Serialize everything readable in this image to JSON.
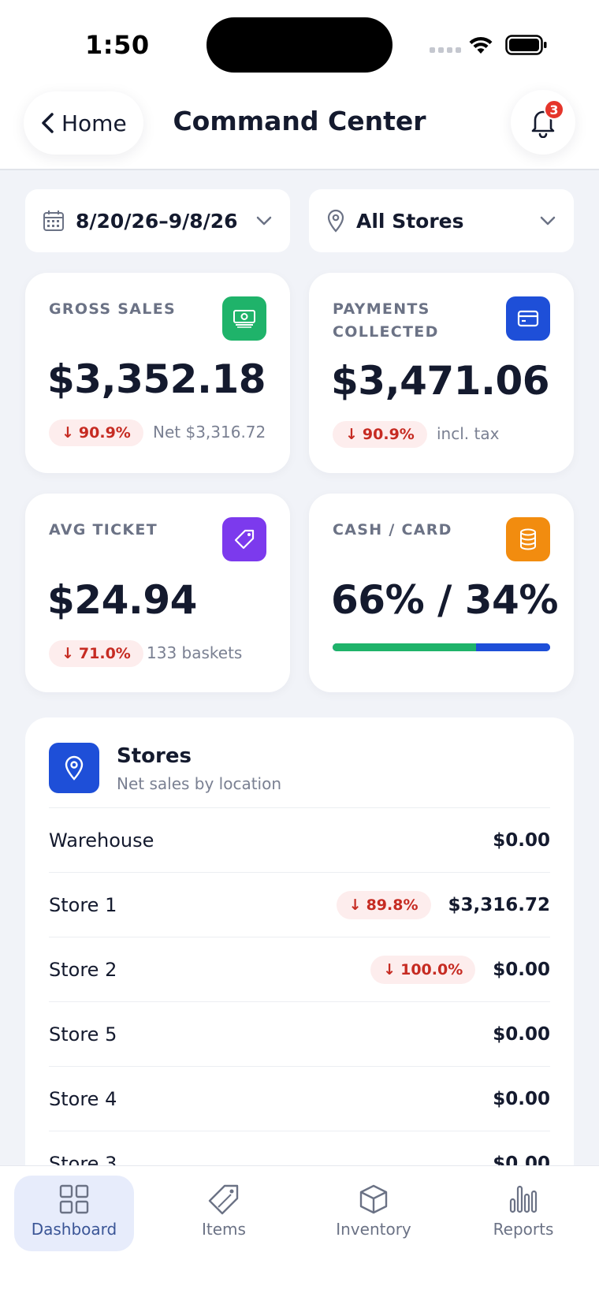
{
  "status_bar": {
    "time": "1:50"
  },
  "header": {
    "back_label": "Home",
    "title": "Command Center",
    "notification_count": "3"
  },
  "filters": {
    "date_range": "8/20/26–9/8/26",
    "store": "All Stores"
  },
  "metrics": {
    "gross_sales": {
      "label": "GROSS SALES",
      "value": "$3,352.18",
      "delta": "90.9%",
      "note": "Net $3,316.72",
      "icon": "banknote-icon",
      "color": "#1fb36a"
    },
    "payments_collected": {
      "label": "PAYMENTS COLLECTED",
      "value": "$3,471.06",
      "delta": "90.9%",
      "note": "incl. tax",
      "icon": "credit-card-icon",
      "color": "#1e4fd8"
    },
    "avg_ticket": {
      "label": "AVG TICKET",
      "value": "$24.94",
      "delta": "71.0%",
      "note": "133 baskets",
      "icon": "tag-icon",
      "color": "#7c3aed"
    },
    "cash_card": {
      "label": "CASH / CARD",
      "value": "66% / 34%",
      "cash_share": 0.66,
      "icon": "database-icon",
      "color": "#f28c0f",
      "cash_color": "#1fb36a",
      "card_color": "#1e4fd8"
    }
  },
  "stores": {
    "title": "Stores",
    "subtitle": "Net sales by location",
    "rows": [
      {
        "name": "Warehouse",
        "amount": "$0.00",
        "delta": ""
      },
      {
        "name": "Store 1",
        "amount": "$3,316.72",
        "delta": "89.8%"
      },
      {
        "name": "Store 2",
        "amount": "$0.00",
        "delta": "100.0%"
      },
      {
        "name": "Store 5",
        "amount": "$0.00",
        "delta": ""
      },
      {
        "name": "Store 4",
        "amount": "$0.00",
        "delta": ""
      },
      {
        "name": "Store 3",
        "amount": "$0.00",
        "delta": ""
      }
    ]
  },
  "bottom_nav": {
    "items": [
      {
        "label": "Dashboard",
        "icon": "grid-icon",
        "active": true
      },
      {
        "label": "Items",
        "icon": "tag-icon",
        "active": false
      },
      {
        "label": "Inventory",
        "icon": "box-icon",
        "active": false
      },
      {
        "label": "Reports",
        "icon": "bar-chart-icon",
        "active": false
      }
    ]
  }
}
